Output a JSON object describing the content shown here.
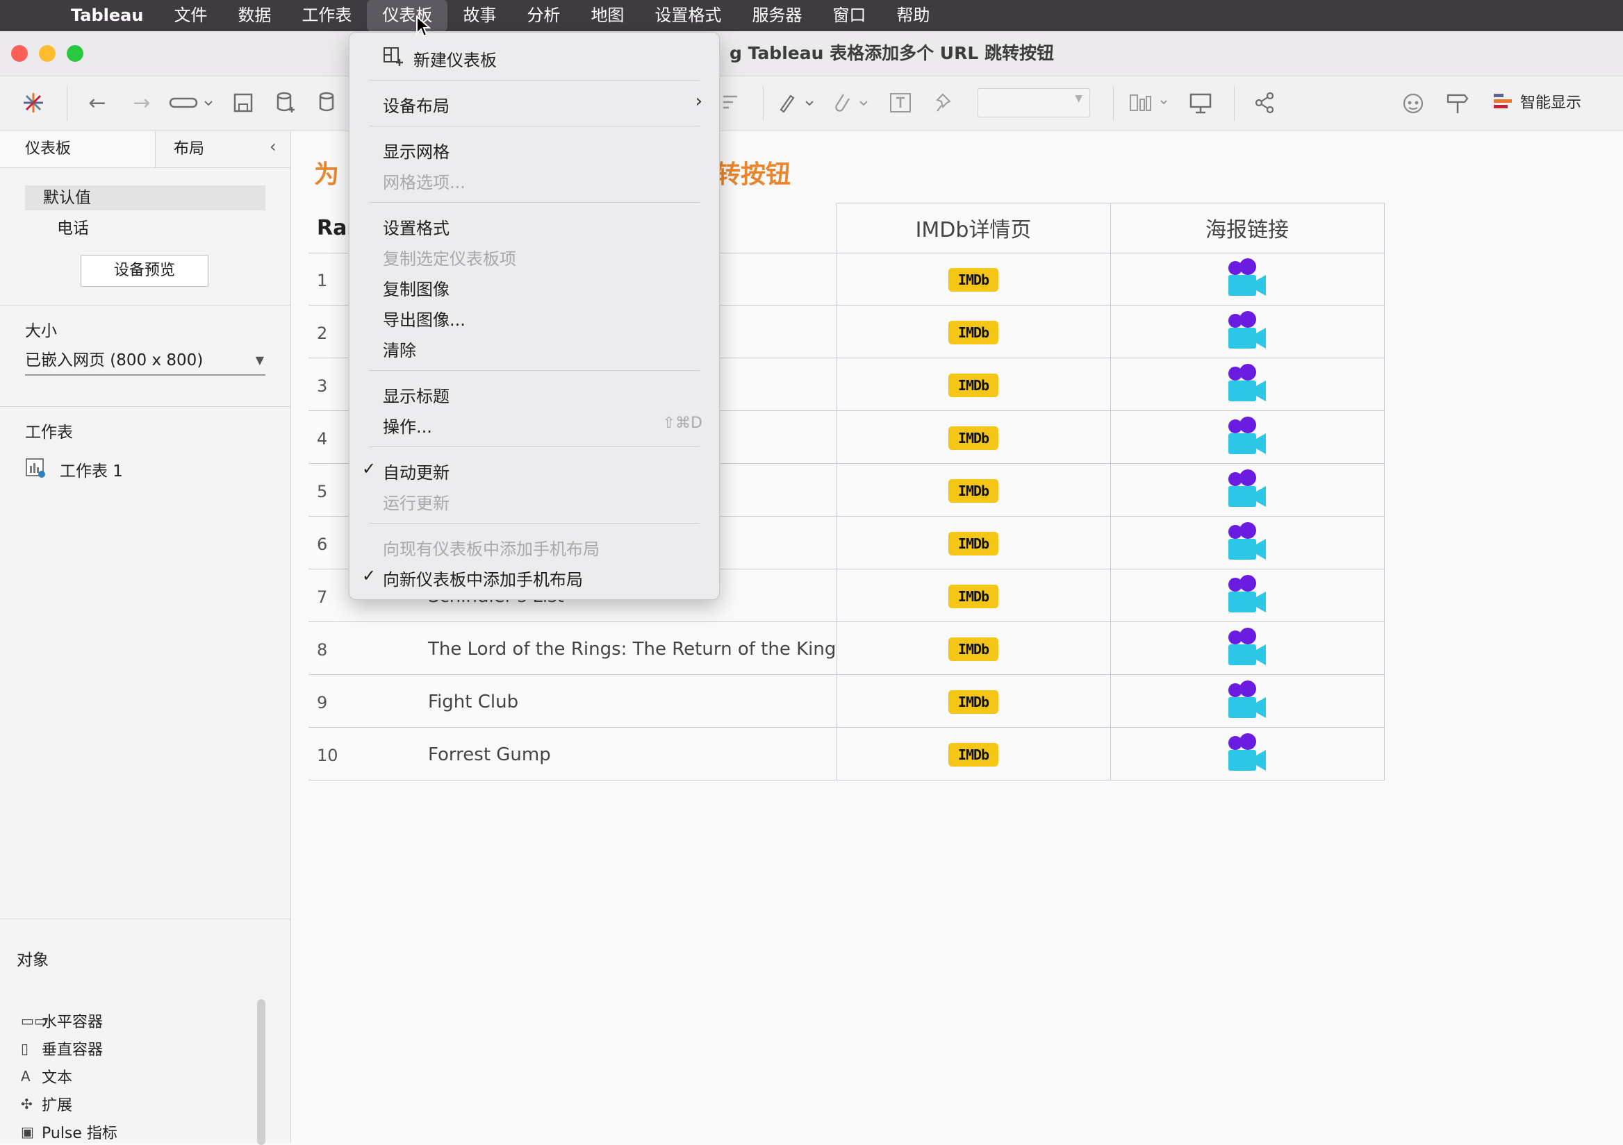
{
  "menubar": {
    "app": "Tableau",
    "items": [
      "文件",
      "数据",
      "工作表",
      "仪表板",
      "故事",
      "分析",
      "地图",
      "设置格式",
      "服务器",
      "窗口",
      "帮助"
    ],
    "active_index": 3
  },
  "window": {
    "title_visible": "g Tableau 表格添加多个 URL 跳转按钮"
  },
  "toolbar": {
    "show_me_label": "智能显示"
  },
  "left_panel": {
    "tabs": [
      "仪表板",
      "布局"
    ],
    "devices": [
      "默认值",
      "电话"
    ],
    "device_preview_button": "设备预览",
    "size_label": "大小",
    "size_value": "已嵌入网页 (800 x 800)",
    "worksheets_label": "工作表",
    "worksheets": [
      "工作表 1"
    ],
    "objects_label": "对象",
    "objects": [
      {
        "icon": "horizontal-container-icon",
        "glyph": "▭▭",
        "label": "水平容器"
      },
      {
        "icon": "vertical-container-icon",
        "glyph": "▯",
        "label": "垂直容器"
      },
      {
        "icon": "text-icon",
        "glyph": "A",
        "label": "文本"
      },
      {
        "icon": "extension-icon",
        "glyph": "✣",
        "label": "扩展"
      },
      {
        "icon": "pulse-metric-icon",
        "glyph": "▣",
        "label": "Pulse 指标"
      }
    ]
  },
  "dashboard": {
    "title_left_visible": "为",
    "title_right_visible": "转按钮",
    "columns": [
      "Rar",
      "IMDb详情页",
      "海报链接"
    ],
    "imdb_badge": "IMDb",
    "rows": [
      {
        "rank": "1",
        "title": ""
      },
      {
        "rank": "2",
        "title": ""
      },
      {
        "rank": "3",
        "title": ""
      },
      {
        "rank": "4",
        "title": ""
      },
      {
        "rank": "5",
        "title": ""
      },
      {
        "rank": "6",
        "title": ""
      },
      {
        "rank": "7",
        "title": "Schindler's List"
      },
      {
        "rank": "8",
        "title": "The Lord of the Rings: The Return of the King"
      },
      {
        "rank": "9",
        "title": "Fight Club"
      },
      {
        "rank": "10",
        "title": "Forrest Gump"
      }
    ]
  },
  "dropdown_menu": {
    "items": [
      {
        "label": "新建仪表板",
        "enabled": true
      },
      {
        "label": "设备布局",
        "enabled": true,
        "submenu": true
      },
      {
        "label": "显示网格",
        "enabled": true
      },
      {
        "label": "网格选项...",
        "enabled": false
      },
      {
        "label": "设置格式",
        "enabled": true
      },
      {
        "label": "复制选定仪表板项",
        "enabled": false
      },
      {
        "label": "复制图像",
        "enabled": true
      },
      {
        "label": "导出图像...",
        "enabled": true
      },
      {
        "label": "清除",
        "enabled": true
      },
      {
        "label": "显示标题",
        "enabled": true
      },
      {
        "label": "操作...",
        "enabled": true,
        "shortcut": "⇧⌘D"
      },
      {
        "label": "自动更新",
        "enabled": true,
        "checked": true
      },
      {
        "label": "运行更新",
        "enabled": false
      },
      {
        "label": "向现有仪表板中添加手机布局",
        "enabled": false
      },
      {
        "label": "向新仪表板中添加手机布局",
        "enabled": true,
        "checked": true
      }
    ]
  },
  "colors": {
    "accent_orange": "#e8862e",
    "imdb_yellow": "#f5c518",
    "menubar_bg": "#403b40"
  }
}
